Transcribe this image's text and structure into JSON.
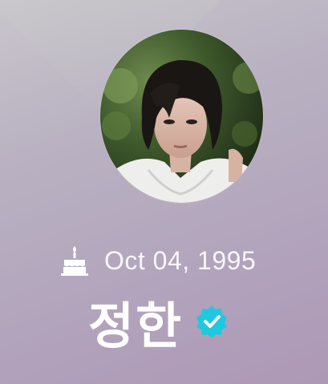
{
  "profile": {
    "avatar_icon": "profile-photo",
    "birthday": {
      "icon": "cake-icon",
      "text": "Oct 04, 1995"
    },
    "name": "정한",
    "verified": {
      "icon": "verified-badge-icon",
      "color": "#1fc8de"
    }
  },
  "colors": {
    "background_top": "#c9c5cc",
    "background_bottom": "#ad98b6",
    "text": "#ffffff"
  }
}
